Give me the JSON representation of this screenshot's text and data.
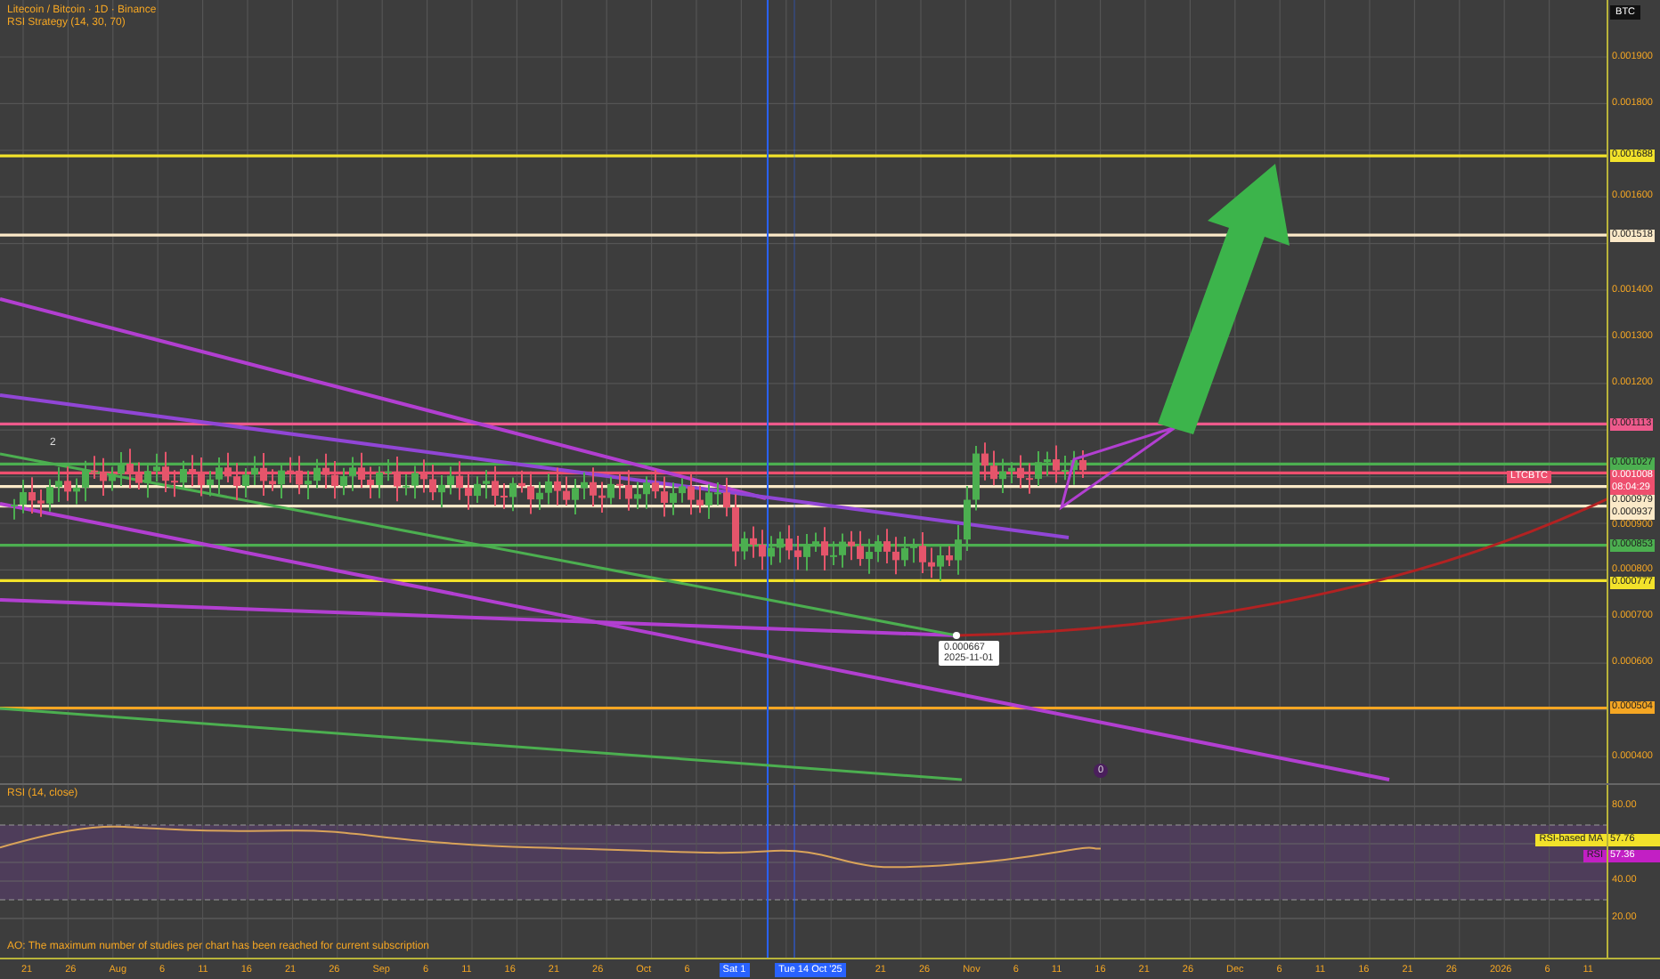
{
  "header": {
    "title": "Litecoin / Bitcoin · 1D · Binance",
    "indicator": "RSI Strategy (14, 30, 70)"
  },
  "candle_note": "2",
  "price_axis": {
    "currency": "BTC",
    "labels": [
      {
        "text": "0.001900",
        "kind": "tick"
      },
      {
        "text": "0.001800",
        "kind": "tick"
      },
      {
        "text": "0.001688",
        "kind": "tag",
        "color": "#f2e22a"
      },
      {
        "text": "0.001600",
        "kind": "tick"
      },
      {
        "text": "0.001518",
        "kind": "tag",
        "color": "#fbe9c8"
      },
      {
        "text": "0.001400",
        "kind": "tick"
      },
      {
        "text": "0.001300",
        "kind": "tick"
      },
      {
        "text": "0.001200",
        "kind": "tick"
      },
      {
        "text": "0.001113",
        "kind": "tag",
        "color": "#ee5a8c"
      },
      {
        "text": "0.001027",
        "kind": "tag",
        "color": "#4caf50"
      },
      {
        "text": "0.001008",
        "kind": "tag",
        "color": "#ee4f6e",
        "sub": "08:04:29",
        "symbol": "LTCBTC"
      },
      {
        "text": "0.000979",
        "kind": "tag",
        "color": "#fbe9c8"
      },
      {
        "text": "0.000937",
        "kind": "tag",
        "color": "#fbe9c8"
      },
      {
        "text": "0.000900",
        "kind": "tick"
      },
      {
        "text": "0.000853",
        "kind": "tag",
        "color": "#4caf50"
      },
      {
        "text": "0.000800",
        "kind": "tick"
      },
      {
        "text": "0.000777",
        "kind": "tag",
        "color": "#f2e22a"
      },
      {
        "text": "0.000700",
        "kind": "tick"
      },
      {
        "text": "0.000600",
        "kind": "tick"
      },
      {
        "text": "0.000504",
        "kind": "tag",
        "color": "#f5a623"
      },
      {
        "text": "0.000400",
        "kind": "tick"
      }
    ]
  },
  "price_callout": {
    "value": "0.000667",
    "date": "2025-11-01"
  },
  "event_marker": "0",
  "rsi_pane": {
    "title": "RSI (14, close)",
    "axis": [
      "80.00",
      "40.00",
      "20.00"
    ],
    "tags": [
      {
        "label": "RSI-based MA",
        "value": "57.76",
        "color": "#f2e22a"
      },
      {
        "label": "RSI",
        "value": "57.36",
        "color": "#c21fc4"
      }
    ]
  },
  "alert": "AO: The maximum number of studies per chart has been reached for current subscription",
  "time_axis": [
    {
      "text": "21",
      "selected": false
    },
    {
      "text": "26",
      "selected": false
    },
    {
      "text": "Aug",
      "selected": false
    },
    {
      "text": "6",
      "selected": false
    },
    {
      "text": "11",
      "selected": false
    },
    {
      "text": "16",
      "selected": false
    },
    {
      "text": "21",
      "selected": false
    },
    {
      "text": "26",
      "selected": false
    },
    {
      "text": "Sep",
      "selected": false
    },
    {
      "text": "6",
      "selected": false
    },
    {
      "text": "11",
      "selected": false
    },
    {
      "text": "16",
      "selected": false
    },
    {
      "text": "21",
      "selected": false
    },
    {
      "text": "26",
      "selected": false
    },
    {
      "text": "Oct",
      "selected": false
    },
    {
      "text": "6",
      "selected": false
    },
    {
      "text": "Sat 1",
      "selected": true
    },
    {
      "text": "Tue 14 Oct '25",
      "selected": true
    },
    {
      "text": "21",
      "selected": false
    },
    {
      "text": "26",
      "selected": false
    },
    {
      "text": "Nov",
      "selected": false
    },
    {
      "text": "6",
      "selected": false
    },
    {
      "text": "11",
      "selected": false
    },
    {
      "text": "16",
      "selected": false
    },
    {
      "text": "21",
      "selected": false
    },
    {
      "text": "26",
      "selected": false
    },
    {
      "text": "Dec",
      "selected": false
    },
    {
      "text": "6",
      "selected": false
    },
    {
      "text": "11",
      "selected": false
    },
    {
      "text": "16",
      "selected": false
    },
    {
      "text": "21",
      "selected": false
    },
    {
      "text": "26",
      "selected": false
    },
    {
      "text": "2026",
      "selected": false
    },
    {
      "text": "6",
      "selected": false
    },
    {
      "text": "11",
      "selected": false
    }
  ]
}
